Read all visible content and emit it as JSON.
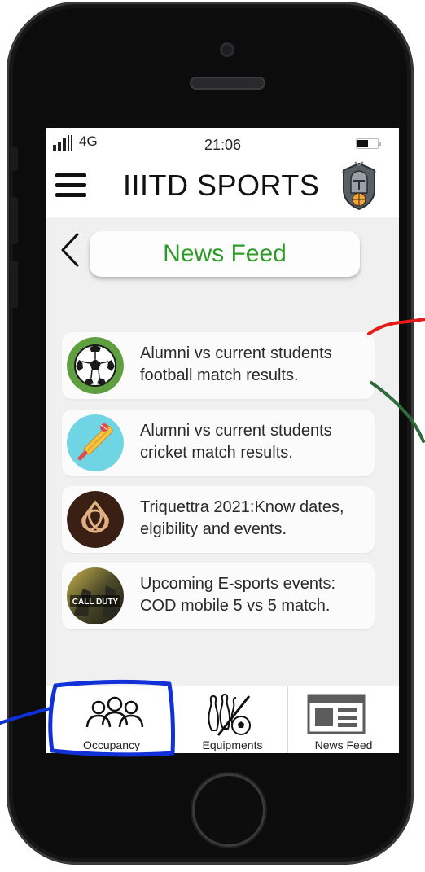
{
  "status_bar": {
    "network": "4G",
    "time": "21:06"
  },
  "header": {
    "title": "IIITD SPORTS",
    "menu_icon": "hamburger-menu-icon",
    "logo_icon": "knight-shield-logo"
  },
  "page": {
    "back_icon": "chevron-left-icon",
    "title": "News Feed",
    "title_color": "#2f9a2a"
  },
  "news": [
    {
      "text": "Alumni vs current students football match results.",
      "icon": "football-icon"
    },
    {
      "text": "Alumni vs current students cricket match results.",
      "icon": "cricket-icon"
    },
    {
      "text": "Triquettra 2021:Know dates, elgibility and events.",
      "icon": "triquetra-icon"
    },
    {
      "text": "Upcoming E-sports events: COD mobile 5 vs 5 match.",
      "icon": "call-of-duty-icon"
    }
  ],
  "nav": [
    {
      "label": "Occupancy",
      "icon": "people-group-icon"
    },
    {
      "label": "Equipments",
      "icon": "equipment-icon"
    },
    {
      "label": "News Feed",
      "icon": "newspaper-icon"
    }
  ],
  "icon_text": {
    "cod_logo": "CALL DUTY"
  },
  "annotation_colors": {
    "red": "#e31b1b",
    "green": "#2e6b3a",
    "blue": "#1030d8"
  }
}
